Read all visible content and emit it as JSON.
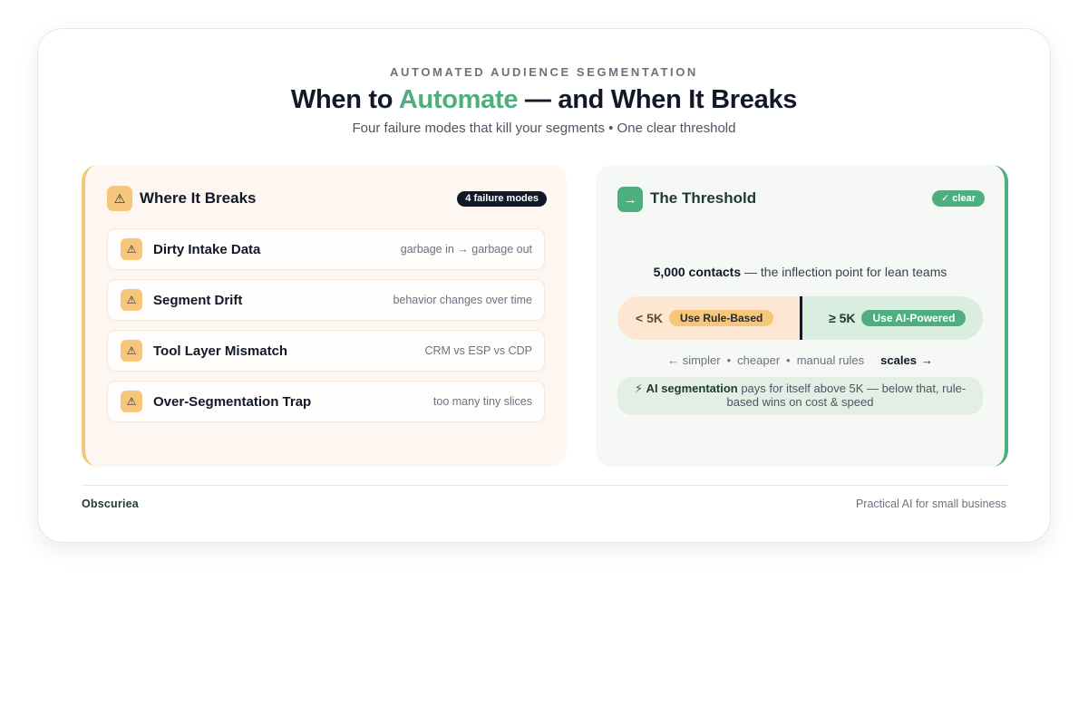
{
  "header": {
    "eyebrow": "AUTOMATED AUDIENCE SEGMENTATION",
    "title_pre": "When to ",
    "title_accent": "Automate",
    "title_post": " — and When It Breaks",
    "subtitle": "Four failure modes that kill your segments • One clear threshold"
  },
  "left_panel": {
    "icon": "warning-icon",
    "title": "Where It Breaks",
    "badge": "4 failure modes",
    "items": [
      {
        "icon": "warning-icon",
        "name": "Dirty Intake Data",
        "desc": "garbage in → garbage out"
      },
      {
        "icon": "warning-icon",
        "name": "Segment Drift",
        "desc": "behavior changes over time"
      },
      {
        "icon": "warning-icon",
        "name": "Tool Layer Mismatch",
        "desc": "CRM vs ESP vs CDP"
      },
      {
        "icon": "warning-icon",
        "name": "Over-Segmentation Trap",
        "desc": "too many tiny slices"
      }
    ]
  },
  "right_panel": {
    "icon": "arrow-right-icon",
    "title": "The Threshold",
    "badge": "✓ clear",
    "threshold_bold": "5,000 contacts",
    "threshold_rest": " — the inflection point for lean teams",
    "split": {
      "left_label": "< 5K",
      "left_pill": "Use Rule-Based",
      "right_label": "≥ 5K",
      "right_pill": "Use AI-Powered"
    },
    "scale": {
      "left_arrow": "←",
      "simpler": "simpler",
      "dot1": "•",
      "cheaper": "cheaper",
      "dot2": "•",
      "manual": "manual rules",
      "scales": "scales",
      "right_arrow": "→"
    },
    "note_icon": "⚡",
    "note_bold": "AI segmentation",
    "note_rest": " pays for itself above 5K — below that, rule-based wins on cost & speed"
  },
  "footer": {
    "brand": "Obscuriea",
    "tagline": "Practical AI for small business"
  },
  "colors": {
    "accent_green": "#4caf7d",
    "accent_amber": "#f6c77a",
    "dark": "#111827"
  }
}
